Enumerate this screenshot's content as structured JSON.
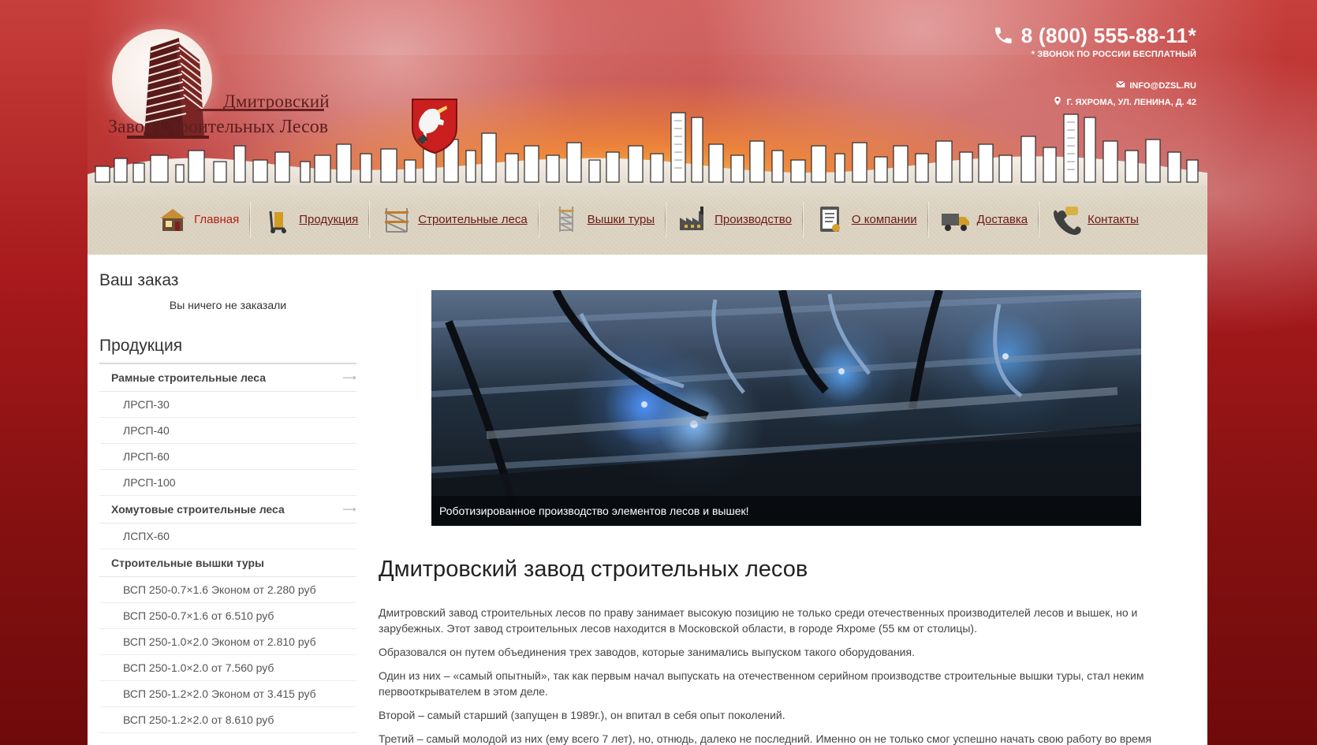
{
  "brand": {
    "line1": "Дмитровский",
    "line2": "Завод Строительных Лесов"
  },
  "contacts": {
    "phone": "8 (800) 555-88-11*",
    "phone_note": "* звонок по России бесплатный",
    "email": "INFO@DZSL.RU",
    "address": "Г. ЯХРОМА, УЛ. ЛЕНИНА, Д. 42"
  },
  "nav": [
    {
      "label": "Главная",
      "icon": "house-icon"
    },
    {
      "label": "Продукция",
      "icon": "cart-icon"
    },
    {
      "label": "Строительные леса",
      "icon": "scaffold-icon"
    },
    {
      "label": "Вышки туры",
      "icon": "tower-icon"
    },
    {
      "label": "Производство",
      "icon": "factory-icon"
    },
    {
      "label": "О компании",
      "icon": "document-icon"
    },
    {
      "label": "Доставка",
      "icon": "truck-icon"
    },
    {
      "label": "Контакты",
      "icon": "phone-icon"
    }
  ],
  "sidebar": {
    "order_title": "Ваш заказ",
    "order_empty": "Вы ничего не заказали",
    "products_title": "Продукция",
    "categories": [
      {
        "label": "Рамные строительные леса",
        "items": [
          "ЛРСП-30",
          "ЛРСП-40",
          "ЛРСП-60",
          "ЛРСП-100"
        ]
      },
      {
        "label": "Хомутовые строительные леса",
        "items": [
          "ЛСПХ-60"
        ]
      },
      {
        "label": "Строительные вышки туры",
        "items": [
          "ВСП 250-0.7×1.6 Эконом от 2.280 руб",
          "ВСП 250-0.7×1.6 от 6.510 руб",
          "ВСП 250-1.0×2.0 Эконом от 2.810 руб",
          "ВСП 250-1.0×2.0 от 7.560 руб",
          "ВСП 250-1.2×2.0 Эконом от 3.415 руб",
          "ВСП 250-1.2×2.0 от 8.610 руб"
        ]
      }
    ]
  },
  "main": {
    "slide_caption": "Роботизированное производство элементов лесов и вышек!",
    "title": "Дмитровский завод строительных лесов",
    "paragraphs": [
      "Дмитровский завод строительных лесов по праву занимает высокую позицию не только среди отечественных производителей лесов и вышек, но и зарубежных. Этот завод строительных лесов находится в Московской области, в городе Яхроме (55 км от столицы).",
      "Образовался он путем объединения трех заводов, которые занимались выпуском такого оборудования.",
      "Один из них – «самый опытный», так как первым начал выпускать на отечественном серийном производстве строительные вышки туры, стал неким первооткрывателем в этом деле.",
      "Второй – самый старший (запущен в 1989г.), он впитал в себя опыт поколений.",
      "Третий – самый молодой из них (ему всего 7 лет), но, отнюдь, далеко не последний. Именно он не только смог успешно начать свою работу во время"
    ]
  },
  "colors": {
    "accent": "#b51d15",
    "background": "#a7191c",
    "nav_background": "#dcd3c1"
  }
}
